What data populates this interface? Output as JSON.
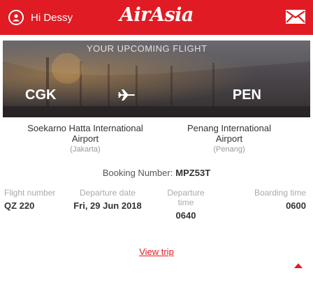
{
  "header": {
    "greeting": "Hi Dessy",
    "logo_text": "AirAsia",
    "icons": {
      "avatar": "user-icon",
      "mail": "mail-icon"
    }
  },
  "trip": {
    "banner": "YOUR UPCOMING FLIGHT",
    "origin_code": "CGK",
    "destination_code": "PEN",
    "origin_airport": "Soekarno Hatta International Airport",
    "origin_city": "(Jakarta)",
    "destination_airport": "Penang International Airport",
    "destination_city": "(Penang)"
  },
  "booking": {
    "label": "Booking Number:",
    "number": "MPZ53T"
  },
  "details": {
    "flight_number_label": "Flight number",
    "flight_number": "QZ 220",
    "departure_date_label": "Departure date",
    "departure_date": "Fri, 29 Jun 2018",
    "departure_time_label": "Departure time",
    "departure_time": "0640",
    "boarding_time_label": "Boarding time",
    "boarding_time": "0600"
  },
  "actions": {
    "view_trip": "View trip"
  },
  "colors": {
    "brand_red": "#e01b23"
  }
}
